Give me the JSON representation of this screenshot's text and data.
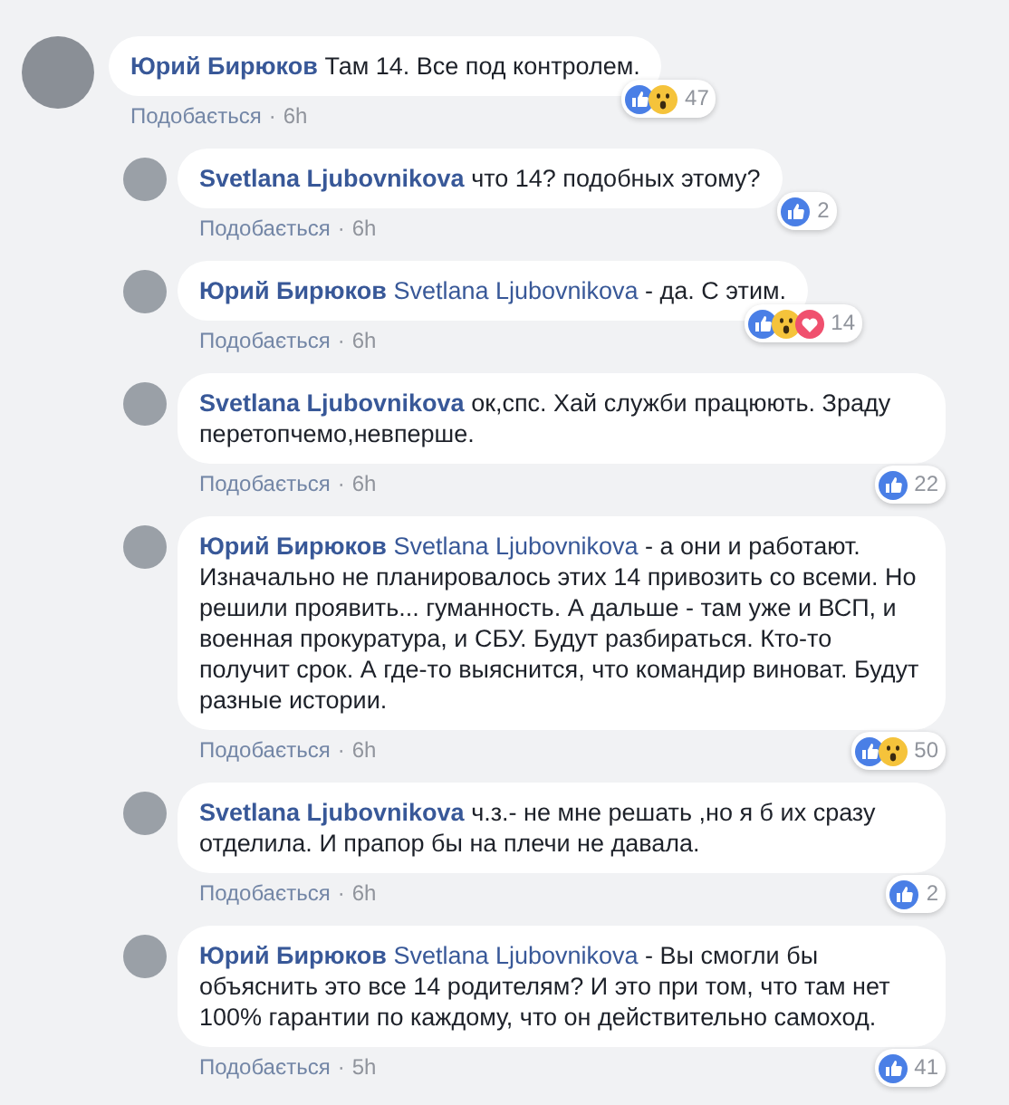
{
  "comments": [
    {
      "author": "Юрий Бирюков",
      "text": "Там 14. Все под контролем.",
      "reactions": [
        {
          "kind": "like"
        },
        {
          "kind": "wow"
        }
      ],
      "count": "47",
      "like": "Подобається",
      "sep": "·",
      "time": "6h",
      "children": [
        {
          "author": "Svetlana Ljubovnikova",
          "text": "что 14? подобных этому?",
          "reactions": [
            {
              "kind": "like"
            }
          ],
          "count": "2",
          "like": "Подобається",
          "sep": "·",
          "time": "6h"
        },
        {
          "author": "Юрий Бирюков",
          "mention": "Svetlana Ljubovnikova",
          "text": "- да. С этим.",
          "reactions": [
            {
              "kind": "like"
            },
            {
              "kind": "wow"
            },
            {
              "kind": "love"
            }
          ],
          "count": "14",
          "like": "Подобається",
          "sep": "·",
          "time": "6h"
        },
        {
          "author": "Svetlana Ljubovnikova",
          "text": "ок,спс. Хай служби працюють. Зраду перетопчемо,невперше.",
          "reactions": [
            {
              "kind": "like"
            }
          ],
          "count": "22",
          "like": "Подобається",
          "sep": "·",
          "time": "6h"
        },
        {
          "author": "Юрий Бирюков",
          "mention": "Svetlana Ljubovnikova",
          "text": "- а они и работают. Изначально не планировалось этих 14 привозить со всеми. Но решили проявить... гуманность. А дальше - там уже и ВСП, и военная прокуратура, и СБУ. Будут разбираться. Кто-то получит срок. А где-то выяснится, что командир виноват. Будут разные истории.",
          "reactions": [
            {
              "kind": "like"
            },
            {
              "kind": "wow"
            }
          ],
          "count": "50",
          "like": "Подобається",
          "sep": "·",
          "time": "6h"
        },
        {
          "author": "Svetlana Ljubovnikova",
          "text": "ч.з.- не мне решать ,но я б их сразу отделила. И прапор бы на плечи не давала.",
          "reactions": [
            {
              "kind": "like"
            }
          ],
          "count": "2",
          "like": "Подобається",
          "sep": "·",
          "time": "6h"
        },
        {
          "author": "Юрий Бирюков",
          "mention": "Svetlana Ljubovnikova",
          "text": "- Вы смогли бы объяснить это все 14 родителям? И это при том, что там нет 100% гарантии по каждому, что он действительно самоход.",
          "reactions": [
            {
              "kind": "like"
            }
          ],
          "count": "41",
          "like": "Подобається",
          "sep": "·",
          "time": "5h"
        }
      ]
    }
  ]
}
